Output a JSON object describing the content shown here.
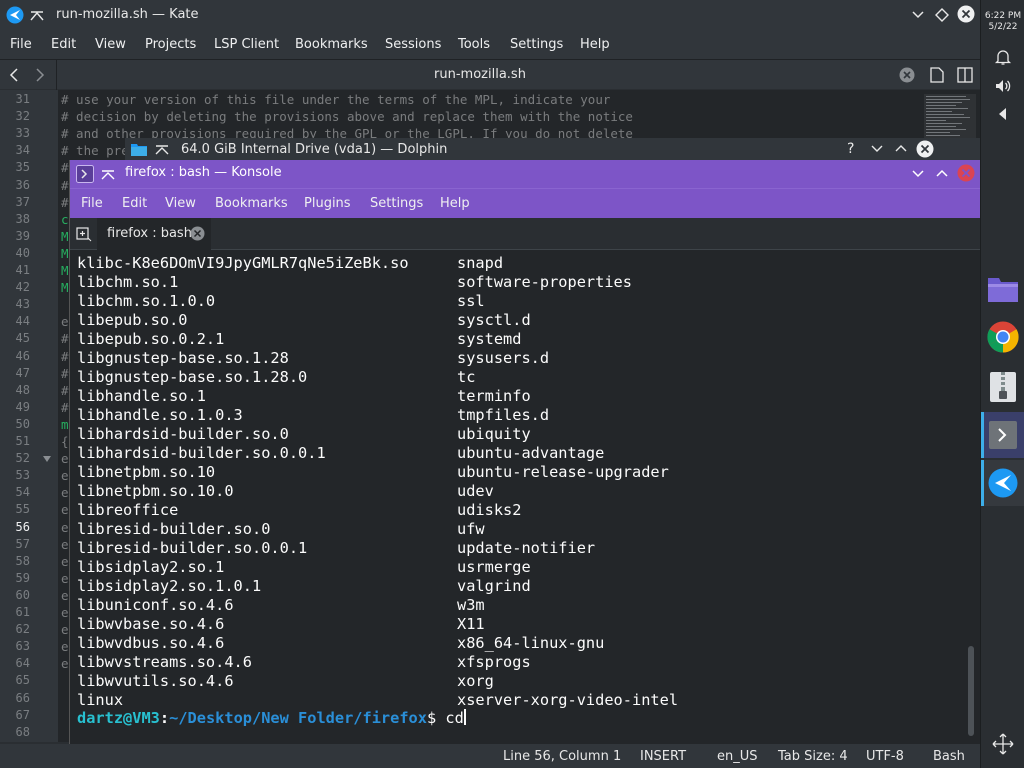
{
  "kate": {
    "title": "run-mozilla.sh — Kate",
    "menu": [
      "File",
      "Edit",
      "View",
      "Projects",
      "LSP Client",
      "Bookmarks",
      "Sessions",
      "Tools",
      "Settings",
      "Help"
    ],
    "tab_title": "run-mozilla.sh",
    "line_numbers": [
      "31",
      "32",
      "33",
      "34",
      "35",
      "36",
      "37",
      "38",
      "39",
      "40",
      "41",
      "42",
      "43",
      "44",
      "45",
      "46",
      "47",
      "48",
      "49",
      "50",
      "51",
      "52",
      "53",
      "54",
      "55",
      "56",
      "57",
      "58",
      "59",
      "60",
      "61",
      "62",
      "63",
      "64",
      "65",
      "66",
      "67",
      "68"
    ],
    "code_lines": [
      "# use your version of this file under the terms of the MPL, indicate your",
      "# decision by deleting the provisions above and replace them with the notice",
      "# and other provisions required by the GPL or the LGPL. If you do not delete",
      "# the pre"
    ],
    "code_fragments": [
      "#",
      "#",
      "#",
      "c",
      "M",
      "M",
      "M",
      "M",
      "",
      "e",
      "#",
      "#",
      "#",
      "#",
      "#",
      "m",
      "{",
      "e",
      "e",
      "e",
      "e",
      "e",
      "e",
      "e",
      "e",
      "e",
      "e",
      "e",
      "e",
      "e"
    ],
    "status": {
      "position": "Line 56, Column 1",
      "mode": "INSERT",
      "language_dictionary": "en_US",
      "tab_size": "Tab Size: 4",
      "encoding": "UTF-8",
      "syntax": "Bash"
    }
  },
  "dolphin": {
    "title": "64.0 GiB Internal Drive (vda1) — Dolphin"
  },
  "konsole": {
    "title": "firefox : bash — Konsole",
    "menu": [
      "File",
      "Edit",
      "View",
      "Bookmarks",
      "Plugins",
      "Settings",
      "Help"
    ],
    "tab_label": "firefox : bash",
    "left_column": [
      "klibc-K8e6DOmVI9JpyGMLR7qNe5iZeBk.so",
      "libchm.so.1",
      "libchm.so.1.0.0",
      "libepub.so.0",
      "libepub.so.0.2.1",
      "libgnustep-base.so.1.28",
      "libgnustep-base.so.1.28.0",
      "libhandle.so.1",
      "libhandle.so.1.0.3",
      "libhardsid-builder.so.0",
      "libhardsid-builder.so.0.0.1",
      "libnetpbm.so.10",
      "libnetpbm.so.10.0",
      "libreoffice",
      "libresid-builder.so.0",
      "libresid-builder.so.0.0.1",
      "libsidplay2.so.1",
      "libsidplay2.so.1.0.1",
      "libuniconf.so.4.6",
      "libwvbase.so.4.6",
      "libwvdbus.so.4.6",
      "libwvstreams.so.4.6",
      "libwvutils.so.4.6",
      "linux"
    ],
    "right_column": [
      "snapd",
      "software-properties",
      "ssl",
      "sysctl.d",
      "systemd",
      "sysusers.d",
      "tc",
      "terminfo",
      "tmpfiles.d",
      "ubiquity",
      "ubuntu-advantage",
      "ubuntu-release-upgrader",
      "udev",
      "udisks2",
      "ufw",
      "update-notifier",
      "usrmerge",
      "valgrind",
      "w3m",
      "X11",
      "x86_64-linux-gnu",
      "xfsprogs",
      "xorg",
      "xserver-xorg-video-intel"
    ],
    "prompt_user": "dartz@VM3",
    "prompt_sep": ":",
    "prompt_path": "~/Desktop/New Folder/firefox",
    "prompt_symbol": "$",
    "command": " cd"
  },
  "panel": {
    "time": "6:22 PM",
    "date": "5/2/22"
  },
  "colors": {
    "konsole_accent": "#7d55c7",
    "prompt_user": "#28c0d0",
    "prompt_path": "#2a8fd8",
    "close_red": "#da4453"
  }
}
